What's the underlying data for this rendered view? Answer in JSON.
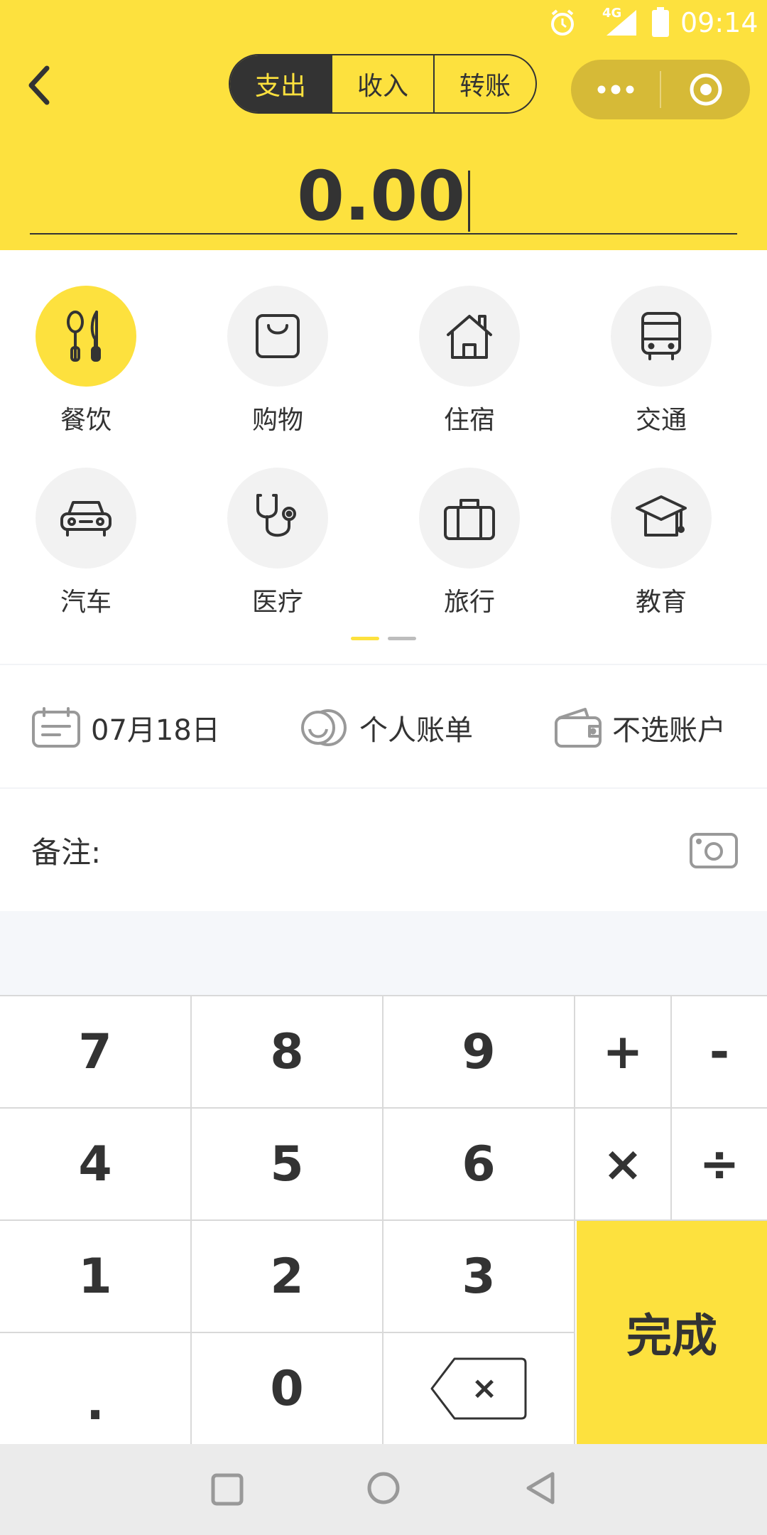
{
  "status_bar": {
    "network": "4G",
    "time": "09:14"
  },
  "header": {
    "tabs": [
      {
        "label": "支出",
        "active": true
      },
      {
        "label": "收入",
        "active": false
      },
      {
        "label": "转账",
        "active": false
      }
    ],
    "capsule_icons": [
      "more-icon",
      "target-icon"
    ],
    "amount": "0.00"
  },
  "categories": [
    {
      "label": "餐饮",
      "icon": "utensils-icon",
      "selected": true
    },
    {
      "label": "购物",
      "icon": "shopping-bag-icon",
      "selected": false
    },
    {
      "label": "住宿",
      "icon": "house-icon",
      "selected": false
    },
    {
      "label": "交通",
      "icon": "bus-icon",
      "selected": false
    },
    {
      "label": "汽车",
      "icon": "car-icon",
      "selected": false
    },
    {
      "label": "医疗",
      "icon": "stethoscope-icon",
      "selected": false
    },
    {
      "label": "旅行",
      "icon": "suitcase-icon",
      "selected": false
    },
    {
      "label": "教育",
      "icon": "graduation-cap-icon",
      "selected": false
    }
  ],
  "pager": {
    "pages": 2,
    "current": 1
  },
  "info": {
    "date": "07月18日",
    "book": "个人账单",
    "account": "不选账户"
  },
  "note": {
    "label": "备注:"
  },
  "keypad": {
    "keys": [
      "7",
      "8",
      "9",
      "+",
      "-",
      "4",
      "5",
      "6",
      "×",
      "÷",
      "1",
      "2",
      "3",
      ".",
      "0"
    ],
    "backspace_symbol": "×",
    "done": "完成"
  },
  "colors": {
    "accent": "#FDE13E",
    "text": "#333333",
    "icon_bg": "#F2F2F2"
  }
}
